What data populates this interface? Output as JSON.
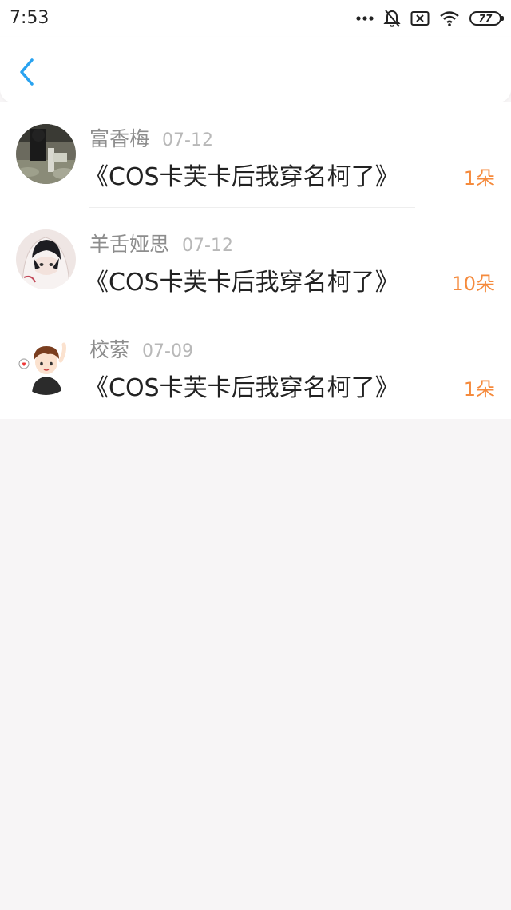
{
  "status_bar": {
    "time": "7:53",
    "battery": "77",
    "icons": [
      "more-dots-icon",
      "bell-off-icon",
      "sim-x-icon",
      "wifi-icon",
      "battery-icon"
    ]
  },
  "header": {
    "back_icon": "chevron-left-icon",
    "accent_color": "#2aa3f0"
  },
  "list": {
    "items": [
      {
        "name": "富香梅",
        "date": "07-12",
        "title": "《COS卡芙卡后我穿名柯了》",
        "count": "1朵",
        "avatar": "avatar-photo-dark"
      },
      {
        "name": "羊舌娅思",
        "date": "07-12",
        "title": "《COS卡芙卡后我穿名柯了》",
        "count": "10朵",
        "avatar": "avatar-anime-hood"
      },
      {
        "name": "校萦",
        "date": "07-09",
        "title": "《COS卡芙卡后我穿名柯了》",
        "count": "1朵",
        "avatar": "avatar-cartoon-boy"
      }
    ]
  },
  "colors": {
    "count": "#f58a3c",
    "name": "#8d8d8d",
    "date": "#b8b8b8",
    "title": "#222222",
    "background": "#f7f5f6"
  }
}
